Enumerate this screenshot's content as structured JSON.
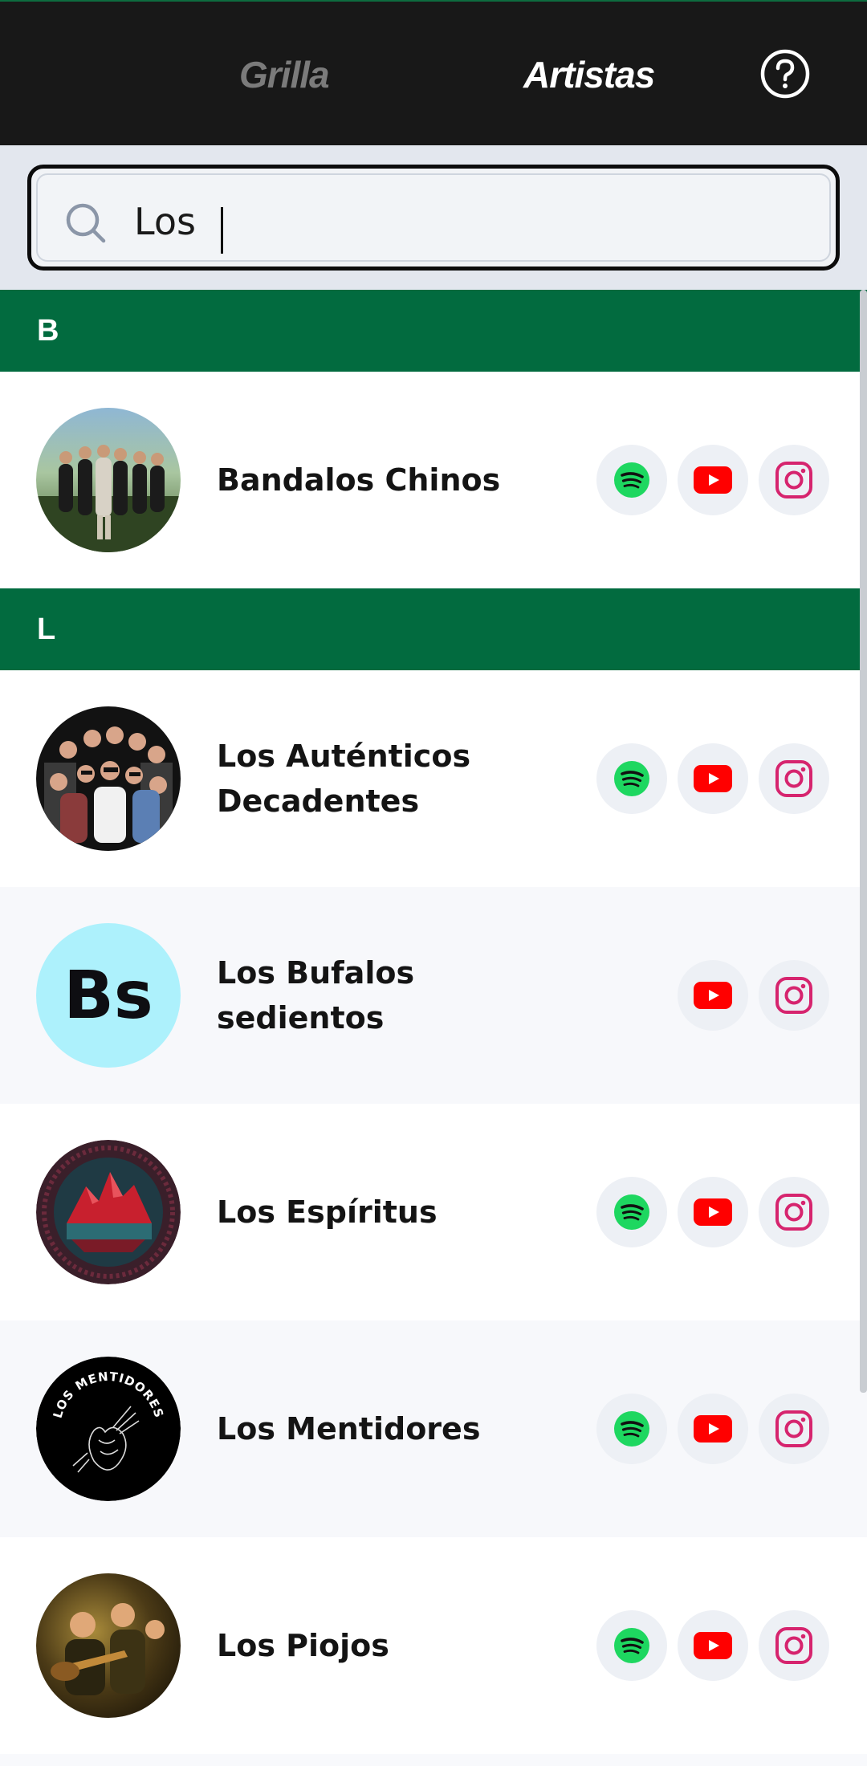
{
  "header": {
    "tabs": [
      {
        "label": "Grilla",
        "active": false
      },
      {
        "label": "Artistas",
        "active": true
      }
    ],
    "help_icon": "question-circle-icon"
  },
  "search": {
    "value": "Los",
    "icon": "search-icon"
  },
  "sections": [
    {
      "letter": "B",
      "artists": [
        {
          "name": "Bandalos Chinos",
          "avatar": "photo",
          "links": [
            "spotify",
            "youtube",
            "instagram"
          ]
        }
      ]
    },
    {
      "letter": "L",
      "artists": [
        {
          "name": "Los Auténticos Decadentes",
          "avatar": "photo",
          "links": [
            "spotify",
            "youtube",
            "instagram"
          ]
        },
        {
          "name": "Los Bufalos sedientos",
          "avatar_initials": "Bs",
          "links": [
            "youtube",
            "instagram"
          ]
        },
        {
          "name": "Los Espíritus",
          "avatar": "artwork",
          "links": [
            "spotify",
            "youtube",
            "instagram"
          ]
        },
        {
          "name": "Los Mentidores",
          "avatar": "logo",
          "avatar_logo_text": "LOS MENTIDORES",
          "links": [
            "spotify",
            "youtube",
            "instagram"
          ]
        },
        {
          "name": "Los Piojos",
          "avatar": "photo",
          "links": [
            "spotify",
            "youtube",
            "instagram"
          ]
        }
      ]
    }
  ],
  "colors": {
    "header_bg": "#181818",
    "section_bg": "#026b3f",
    "spotify": "#1ed760",
    "youtube": "#ff0000",
    "instagram": "#d6246e",
    "initials_avatar_bg": "#adf1fc"
  }
}
